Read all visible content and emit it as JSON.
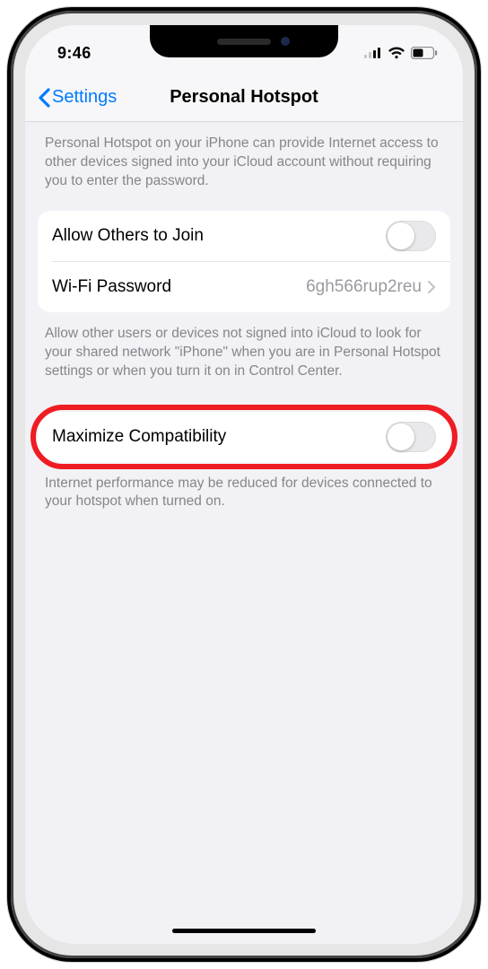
{
  "status": {
    "time": "9:46"
  },
  "nav": {
    "back_label": "Settings",
    "title": "Personal Hotspot"
  },
  "intro": "Personal Hotspot on your iPhone can provide Internet access to other devices signed into your iCloud account without requiring you to enter the password.",
  "group1": {
    "allow_label": "Allow Others to Join",
    "wifi_label": "Wi-Fi Password",
    "wifi_value": "6gh566rup2reu"
  },
  "footer1": "Allow other users or devices not signed into iCloud to look for your shared network \"iPhone\" when you are in Personal Hotspot settings or when you turn it on in Control Center.",
  "group2": {
    "maxcompat_label": "Maximize Compatibility"
  },
  "footer2": "Internet performance may be reduced for devices connected to your hotspot when turned on."
}
